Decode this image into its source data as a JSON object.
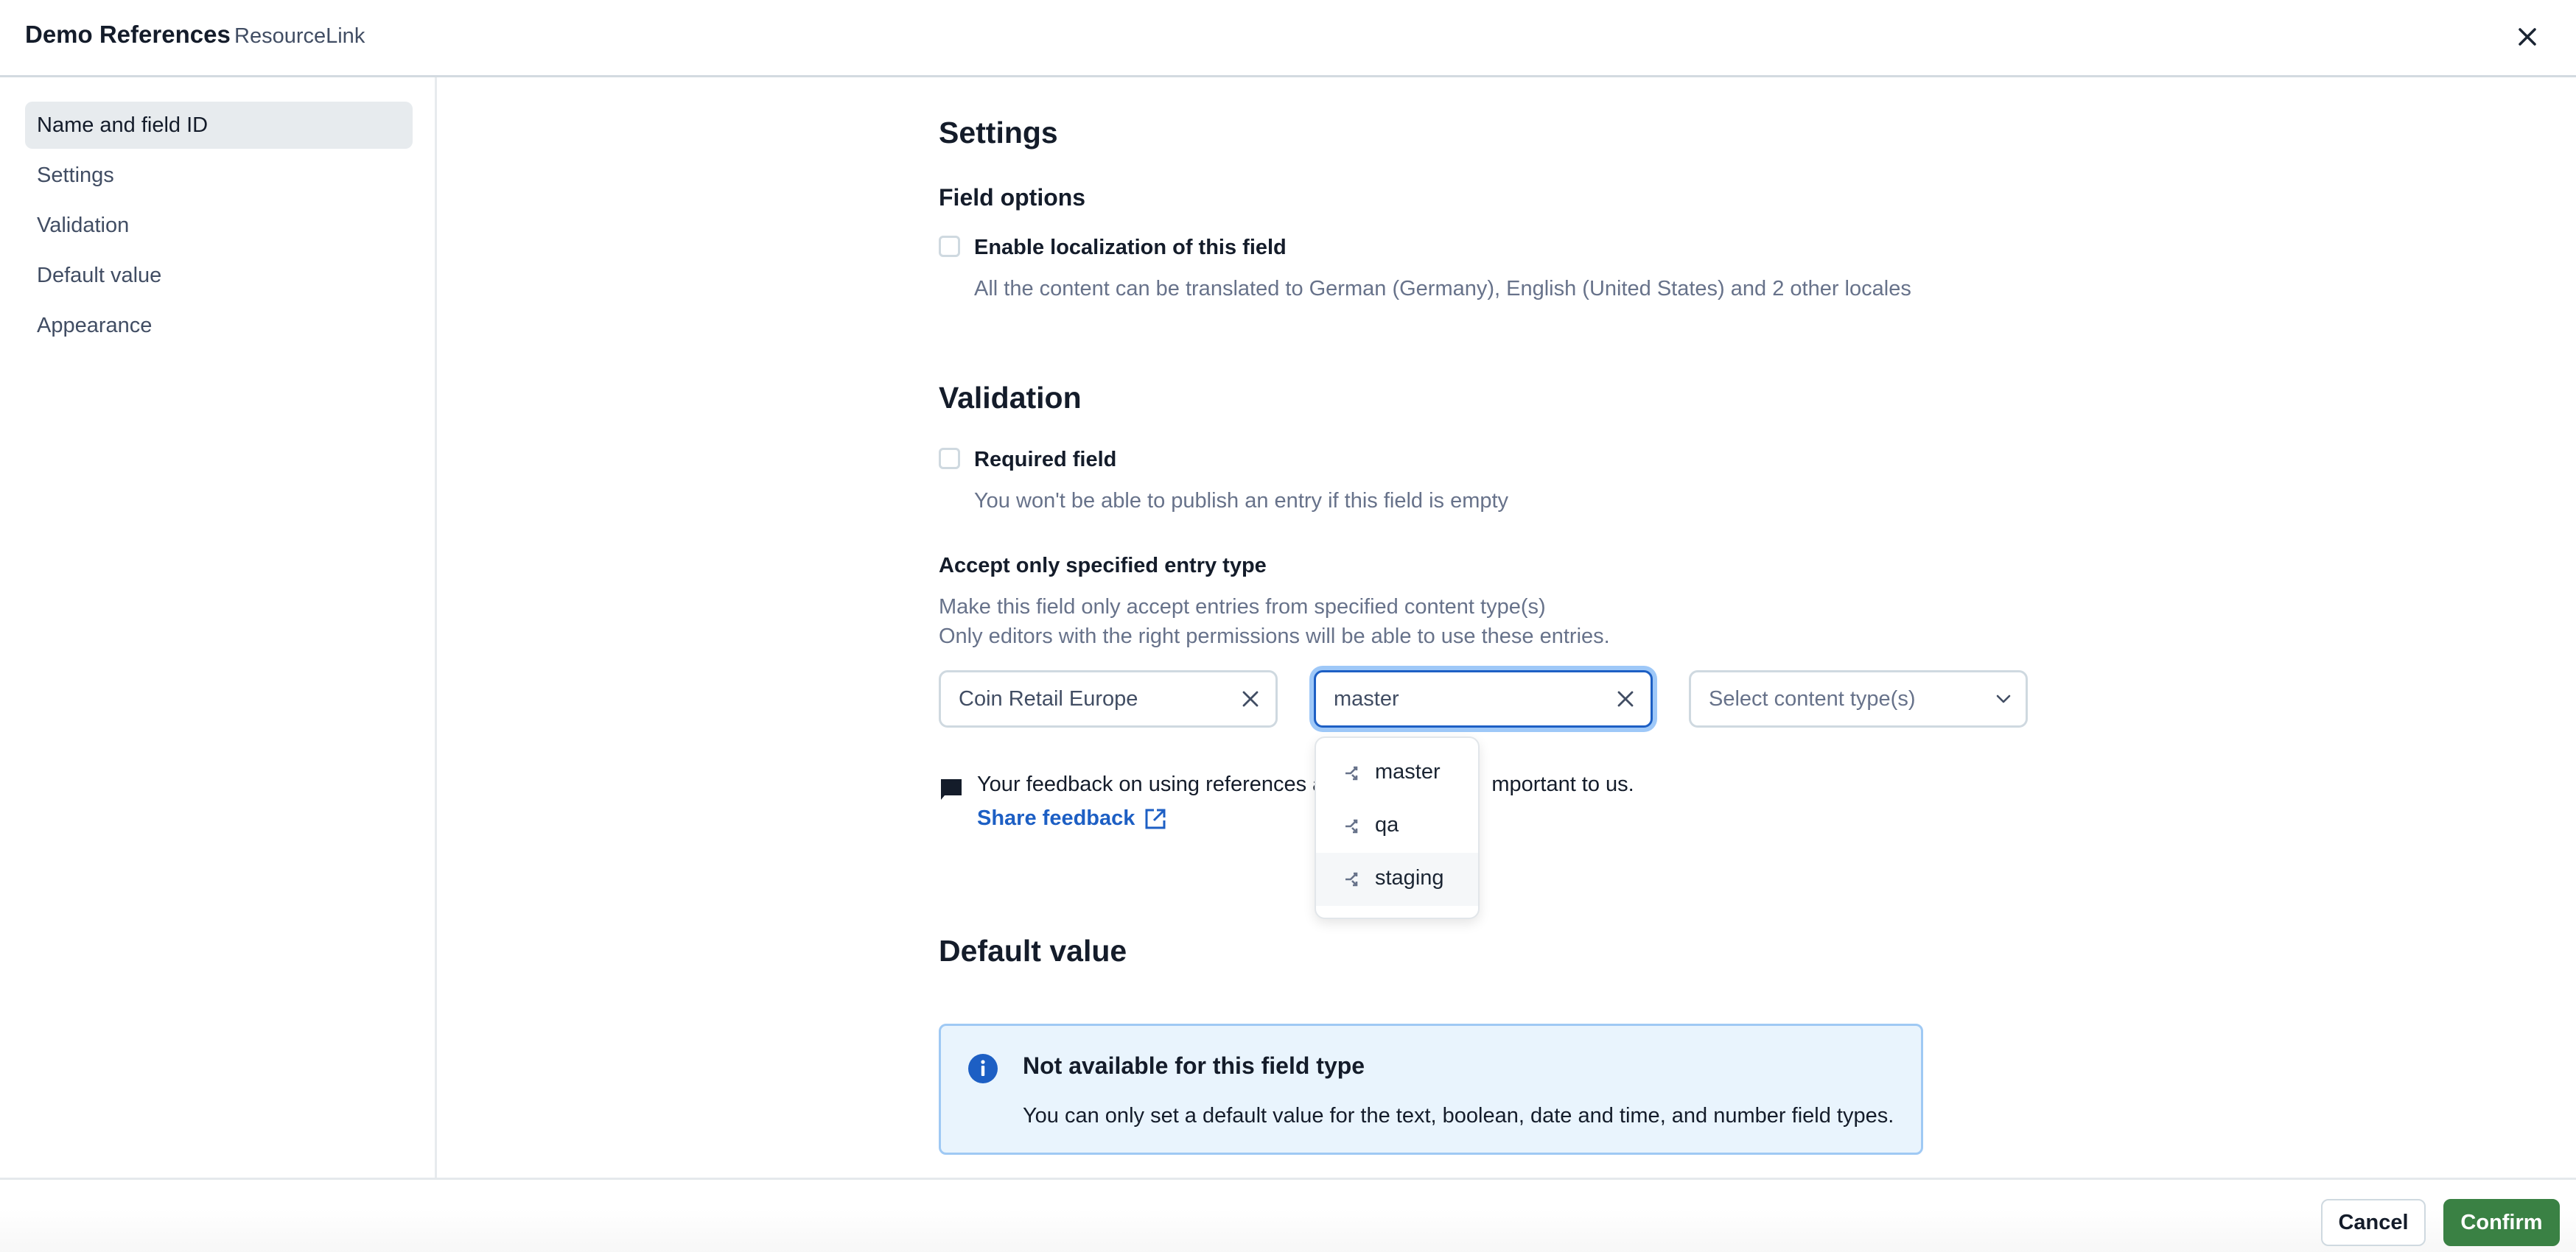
{
  "header": {
    "title": "Demo References",
    "subtitle": "ResourceLink",
    "close_icon": "close-icon"
  },
  "sidebar": {
    "items": [
      {
        "label": "Name and field ID",
        "active": true
      },
      {
        "label": "Settings",
        "active": false
      },
      {
        "label": "Validation",
        "active": false
      },
      {
        "label": "Default value",
        "active": false
      },
      {
        "label": "Appearance",
        "active": false
      }
    ]
  },
  "settings": {
    "heading": "Settings",
    "field_options_heading": "Field options",
    "localization": {
      "label": "Enable localization of this field",
      "checked": false,
      "help": "All the content can be translated to German (Germany), English (United States) and 2 other locales"
    }
  },
  "validation": {
    "heading": "Validation",
    "required": {
      "label": "Required field",
      "checked": false,
      "help": "You won't be able to publish an entry if this field is empty"
    },
    "accept_entry_type": {
      "label": "Accept only specified entry type",
      "help_line1": "Make this field only accept entries from specified content type(s)",
      "help_line2": "Only editors with the right permissions will be able to use these entries.",
      "space_field": {
        "value": "Coin Retail Europe",
        "icon": "close-icon"
      },
      "environment_field": {
        "value": "master",
        "icon": "close-icon",
        "focused": true
      },
      "content_type_field": {
        "placeholder": "Select content type(s)",
        "icon": "chevron-down-icon"
      },
      "environment_options": [
        {
          "label": "master",
          "icon": "environment-branch-icon"
        },
        {
          "label": "qa",
          "icon": "environment-branch-icon"
        },
        {
          "label": "staging",
          "icon": "environment-branch-icon",
          "hovered": true
        }
      ]
    },
    "feedback": {
      "icon": "chat-bubble-icon",
      "text_before": "Your feedback on using references a",
      "text_after": "mportant to us.",
      "link_label": "Share feedback",
      "link_icon": "external-link-icon"
    }
  },
  "default_value": {
    "heading": "Default value",
    "note": {
      "icon": "info-icon",
      "title": "Not available for this field type",
      "text": "You can only set a default value for the text, boolean, date and time, and number field types."
    }
  },
  "footer": {
    "cancel_label": "Cancel",
    "confirm_label": "Confirm"
  },
  "colors": {
    "primary": "#1d5fc4",
    "confirm": "#3a8144",
    "note_background": "#e9f4fd"
  }
}
